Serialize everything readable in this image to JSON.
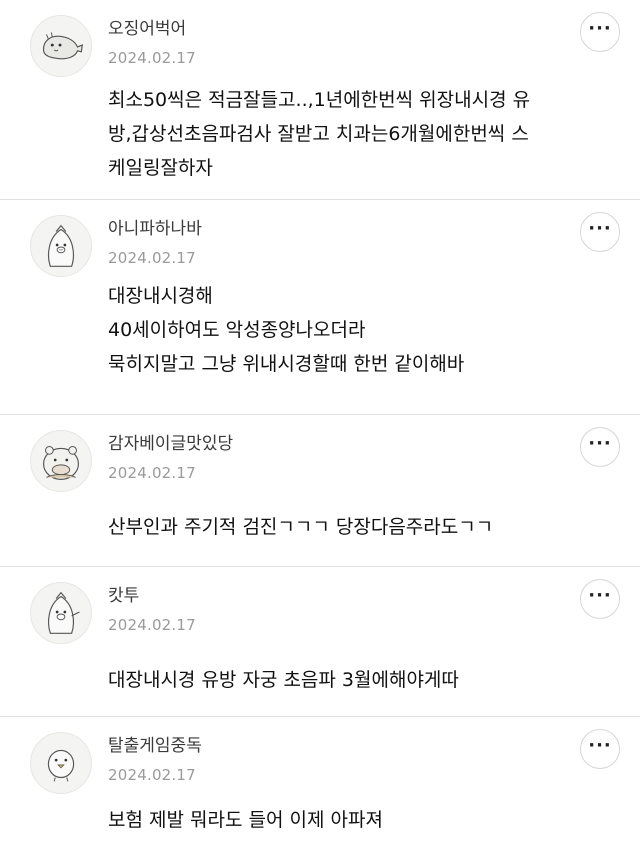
{
  "comments": [
    {
      "nickname": "오징어벅어",
      "date": "2024.02.17",
      "text": "최소50씩은 적금잘들고..,1년에한번씩 위장내시경 유\n방,갑상선초음파검사 잘받고 치과는6개월에한번씩 스\n케일링잘하자",
      "avatar_icon": "whale-character-icon",
      "more_label": "···"
    },
    {
      "nickname": "아니파하나바",
      "date": "2024.02.17",
      "text": "대장내시경해\n40세이하여도 악성종양나오더라\n묵히지말고 그냥 위내시경할때 한번 같이해바",
      "avatar_icon": "pig-penguin-character-icon",
      "more_label": "···"
    },
    {
      "nickname": "감자베이글맛있당",
      "date": "2024.02.17",
      "text": "산부인과 주기적 검진ㄱㄱㄱ  당장다음주라도ㄱㄱ",
      "avatar_icon": "hippo-character-icon",
      "more_label": "···"
    },
    {
      "nickname": "캇투",
      "date": "2024.02.17",
      "text": "대장내시경 유방 자궁 초음파 3월에해야게따",
      "avatar_icon": "pig-penguin-character-icon",
      "more_label": "···"
    },
    {
      "nickname": "탈출게임중독",
      "date": "2024.02.17",
      "text": "보험 제발 뭐라도 들어 이제 아파져",
      "avatar_icon": "chick-character-icon",
      "more_label": "···"
    }
  ]
}
